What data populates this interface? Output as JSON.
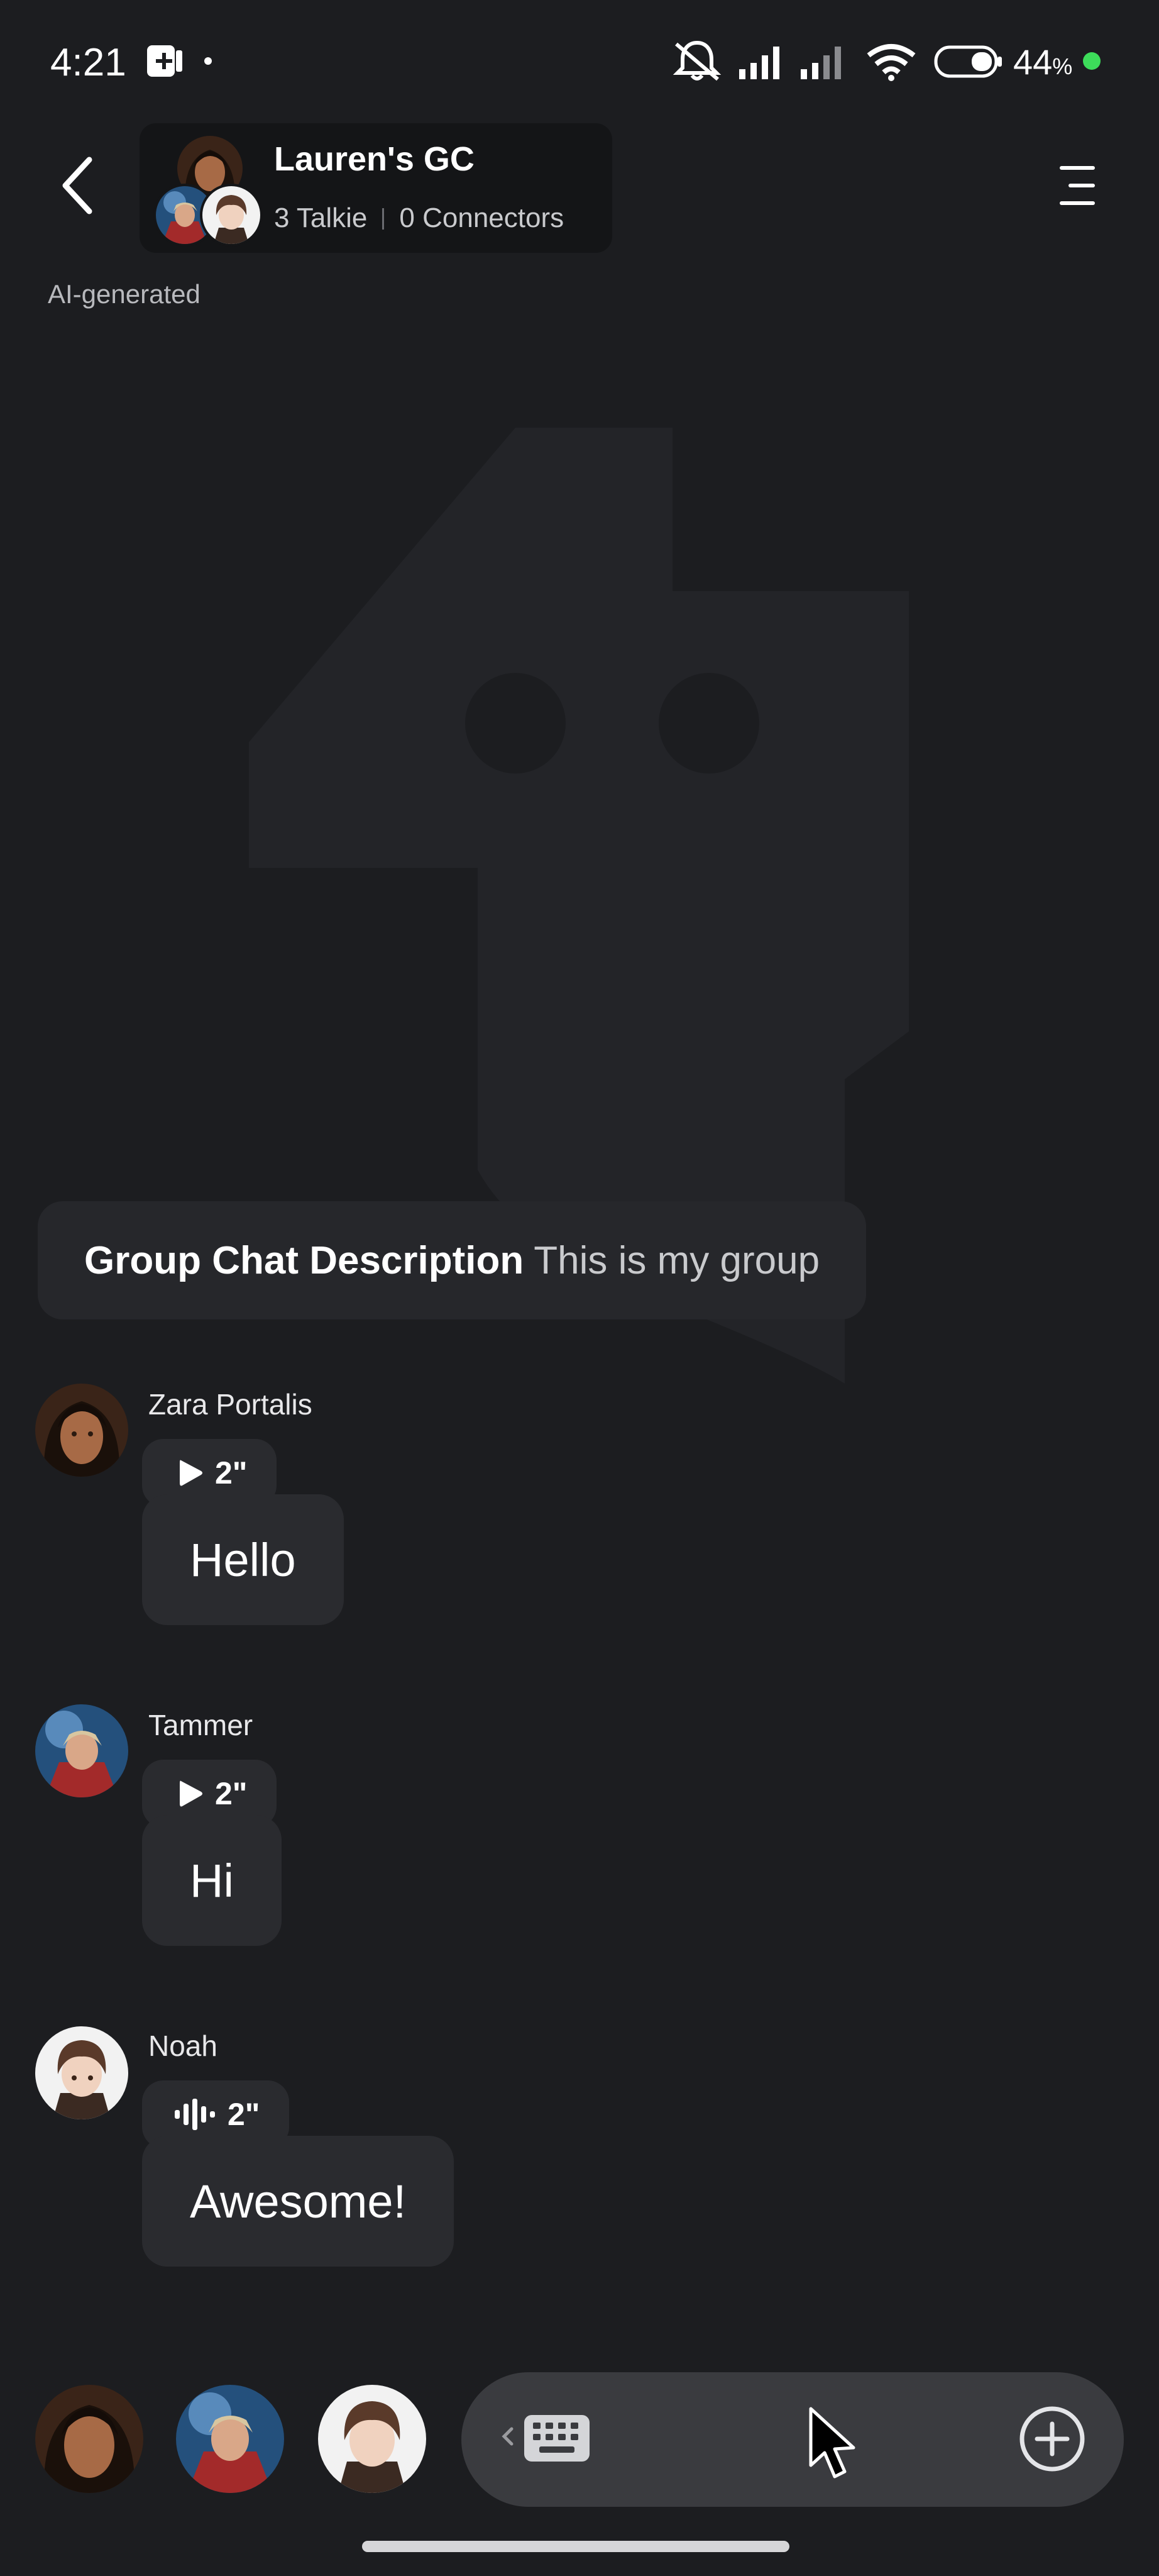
{
  "status_bar": {
    "time": "4:21",
    "battery_percent": "44",
    "percent_sign": "%",
    "icons": [
      "app-notification-icon",
      "mute-icon",
      "signal-icon",
      "signal-icon",
      "wifi-icon",
      "battery-icon",
      "privacy-dot-icon"
    ]
  },
  "header": {
    "group_name": "Lauren's GC",
    "talkie_count": "3 Talkie",
    "connectors": "0 Connectors",
    "ai_label": "AI-generated"
  },
  "description": {
    "label": "Group Chat Description",
    "text": "This is my group"
  },
  "messages": [
    {
      "sender": "Zara Portalis",
      "duration": "2\"",
      "text": "Hello",
      "playing": false
    },
    {
      "sender": "Tammer",
      "duration": "2\"",
      "text": "Hi",
      "playing": false
    },
    {
      "sender": "Noah",
      "duration": "2\"",
      "text": "Awesome!",
      "playing": true
    }
  ],
  "colors": {
    "background": "#1c1d20",
    "bubble": "#2a2b2f",
    "composer": "#3a3b3f",
    "accent_green": "#3ddc5a"
  }
}
